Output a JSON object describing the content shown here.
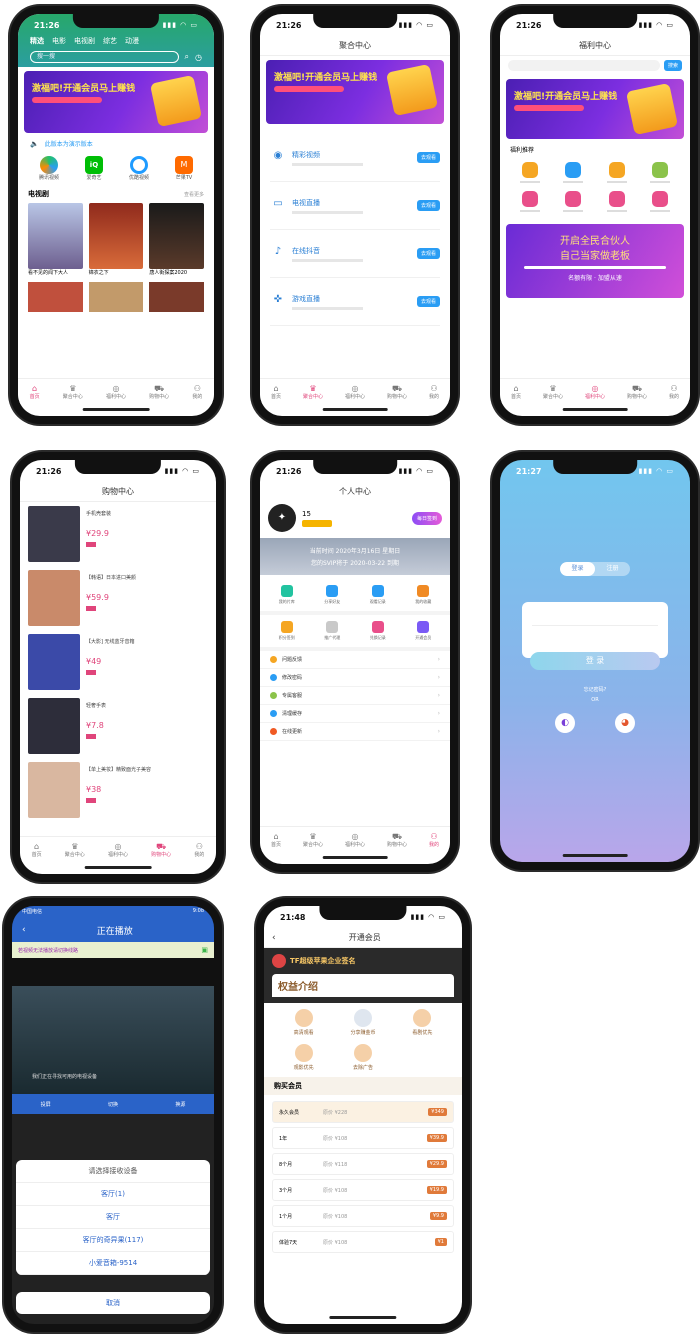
{
  "phone1": {
    "time": "21:26",
    "tabs": [
      "精选",
      "电影",
      "电视剧",
      "综艺",
      "动漫"
    ],
    "search_placeholder": "搜一搜",
    "banner_text": "激福吧!开通会员马上赚钱",
    "notice": "此版本为演示版本",
    "apps": [
      "腾讯视频",
      "爱奇艺",
      "优酷视频",
      "芒果TV"
    ],
    "section_title": "电视剧",
    "section_more": "查看更多",
    "dramas": [
      "看不见的闻下大人",
      "锦衣之下",
      "唐人街探案2020"
    ],
    "tabbar": [
      "首页",
      "聚合中心",
      "福利中心",
      "购物中心",
      "我的"
    ]
  },
  "phone2": {
    "time": "21:26",
    "title": "聚合中心",
    "banner_text": "激福吧!开通会员马上赚钱",
    "items": [
      {
        "name": "精彩视频",
        "btn": "去观看",
        "icon": "globe-icon"
      },
      {
        "name": "电视直播",
        "btn": "去观看",
        "icon": "tv-icon"
      },
      {
        "name": "在线抖音",
        "btn": "去观看",
        "icon": "tiktok-icon"
      },
      {
        "name": "游戏直播",
        "btn": "去观看",
        "icon": "game-icon"
      }
    ]
  },
  "phone3": {
    "time": "21:26",
    "title": "福利中心",
    "search_btn": "搜索",
    "section": "福利推荐",
    "promo_line1": "开启全民合伙人",
    "promo_line2": "自己当家做老板",
    "promo_sub": "名额有限 · 加盟从速"
  },
  "phone4": {
    "time": "21:26",
    "title": "购物中心",
    "products": [
      {
        "name": "手机壳套装",
        "price": "¥29.9",
        "color": "#3a3a4a"
      },
      {
        "name": "【韩语】日本进口美颜",
        "price": "¥59.9",
        "color": "#c98a6a"
      },
      {
        "name": "【大影] 无线蓝牙音箱",
        "price": "¥49",
        "color": "#3b4aa8"
      },
      {
        "name": "轻奢手表",
        "price": "¥7.8",
        "color": "#2d2d3a"
      },
      {
        "name": "【单上美妆】精致面光子美容",
        "price": "¥38",
        "color": "#d9b7a0"
      }
    ]
  },
  "phone5": {
    "time": "21:26",
    "title": "个人中心",
    "user_id": "15",
    "vip_badge": "每日签到",
    "date_line": "当前时间 2020年3月16日 星期日",
    "vip_line": "您的SVIP将于 2020-03-22 到期",
    "grid": [
      "我的片库",
      "分享好友",
      "观看记录",
      "我的收藏"
    ],
    "grid2": [
      "积分签到",
      "推广代理",
      "兑换记录",
      "开通会员"
    ],
    "menu": [
      "问题反馈",
      "修改密码",
      "专属客服",
      "清理缓存",
      "在线更新"
    ]
  },
  "phone6": {
    "time": "21:27",
    "tab_login": "登录",
    "tab_register": "注册",
    "login_btn": "登 录",
    "forgot": "忘记密码?",
    "or": "OR"
  },
  "phone7": {
    "carrier": "中国电信",
    "clock": "9:08",
    "title": "正在播放",
    "ad_text": "若视频无法播放请切换线路",
    "video_caption": "我们正在寻找可用的电视设备",
    "controls": [
      "投屏",
      "切换",
      "换源"
    ],
    "sheet_title": "请选择接收设备",
    "devices": [
      "客厅(1)",
      "客厅",
      "客厅的奇异果(117)",
      "小爱音箱-9514"
    ],
    "cancel": "取消"
  },
  "phone8": {
    "time": "21:48",
    "title": "开通会员",
    "header": "TF超级苹果企业签名",
    "rights_title": "权益介绍",
    "rights": [
      "高清观看",
      "分享赚金币",
      "看剧优先",
      "观影优先",
      "去除广告"
    ],
    "buy_title": "购买会员",
    "plans": [
      {
        "name": "永久会员",
        "orig": "原价 ¥228",
        "price": "¥349"
      },
      {
        "name": "1年",
        "orig": "原价 ¥108",
        "price": "¥39.9"
      },
      {
        "name": "8个月",
        "orig": "原价 ¥118",
        "price": "¥29.9"
      },
      {
        "name": "3个月",
        "orig": "原价 ¥108",
        "price": "¥19.9"
      },
      {
        "name": "1个月",
        "orig": "原价 ¥108",
        "price": "¥9.9"
      },
      {
        "name": "体验7天",
        "orig": "原价 ¥108",
        "price": "¥1"
      }
    ]
  }
}
